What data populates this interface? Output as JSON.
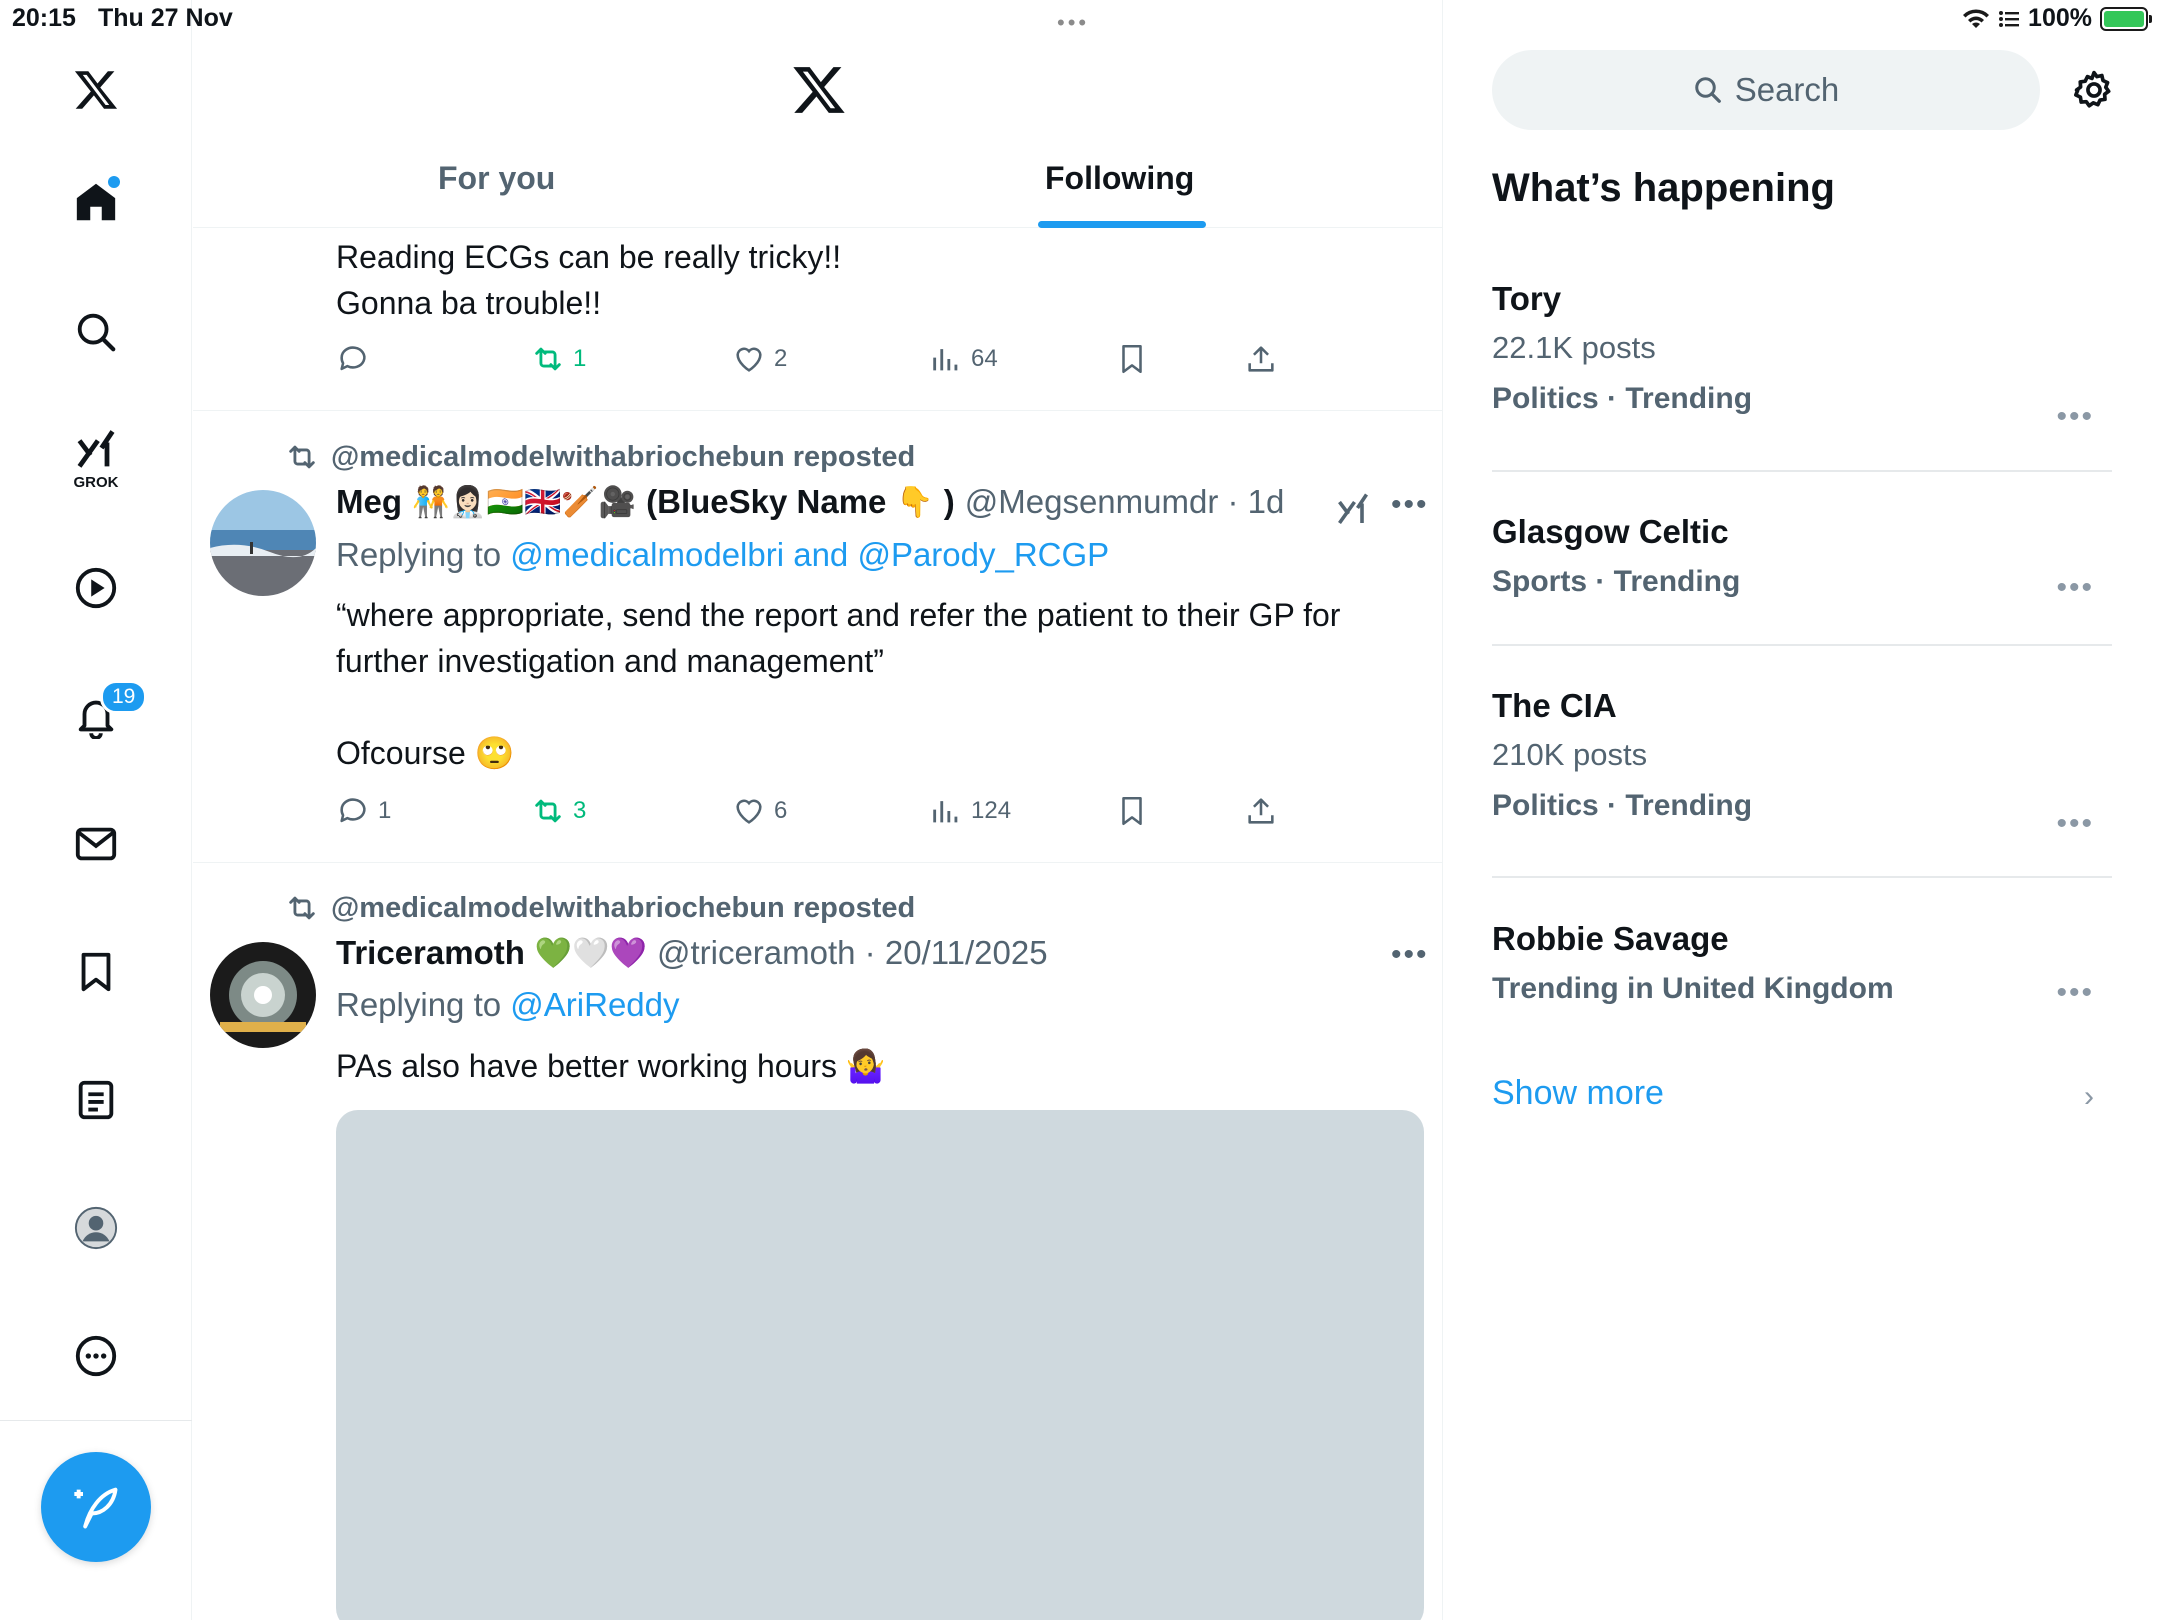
{
  "status_bar": {
    "time": "20:15",
    "date": "Thu 27 Nov",
    "multitask_dots": "•••",
    "battery": "100%"
  },
  "nav": {
    "grok_label": "GROK",
    "notifications_count": "19"
  },
  "header": {
    "tabs": [
      {
        "label": "For you"
      },
      {
        "label": "Following"
      }
    ],
    "active_tab": "Following"
  },
  "posts": [
    {
      "text_lines": [
        "Reading ECGs  can be really tricky!!",
        "Gonna ba trouble!!"
      ],
      "actions": {
        "replies": "",
        "reposts": "1",
        "likes": "2",
        "views": "64"
      }
    },
    {
      "reposted_by": "@medicalmodelwithabriochebun reposted",
      "author_name": "Meg",
      "author_emojis": "🧑‍🤝‍🧑👩🏻‍⚕️🇮🇳🇬🇧🏏🎥",
      "author_suffix": "(BlueSky Name",
      "author_suffix_emoji": "👇",
      "author_suffix_close": ")",
      "handle_time": "@Megsenmumdr · 1d",
      "replying_prefix": "Replying to",
      "replying_to": "@medicalmodelbri and @Parody_RCGP",
      "text_lines": [
        "“where appropriate, send the report and refer the patient to their GP for",
        "further investigation and management”"
      ],
      "text_line_3": "Ofcourse",
      "text_line_3_emoji": "🙄",
      "actions": {
        "replies": "1",
        "reposts": "3",
        "likes": "6",
        "views": "124"
      }
    },
    {
      "reposted_by": "@medicalmodelwithabriochebun reposted",
      "author_name": "Triceramoth",
      "author_emojis": "💚🤍💜",
      "handle_time": "@triceramoth · 20/11/2025",
      "replying_prefix": "Replying to",
      "replying_to": "@AriReddy",
      "text": "PAs also have better working hours",
      "text_emoji": "🤷‍♀️"
    }
  ],
  "sidebar": {
    "search_placeholder": "Search",
    "section_title": "What’s happening",
    "trends": [
      {
        "topic": "Tory",
        "posts": "22.1K posts",
        "category": "Politics · Trending"
      },
      {
        "topic": "Glasgow Celtic",
        "posts": "",
        "category": "Sports · Trending"
      },
      {
        "topic": "The CIA",
        "posts": "210K posts",
        "category": "Politics · Trending"
      },
      {
        "topic": "Robbie Savage",
        "posts": "",
        "category": "Trending in United Kingdom"
      }
    ],
    "show_more": "Show more"
  },
  "colors": {
    "accent": "#1d9bf0",
    "repost_green": "#00ba7c",
    "muted": "#536471"
  }
}
